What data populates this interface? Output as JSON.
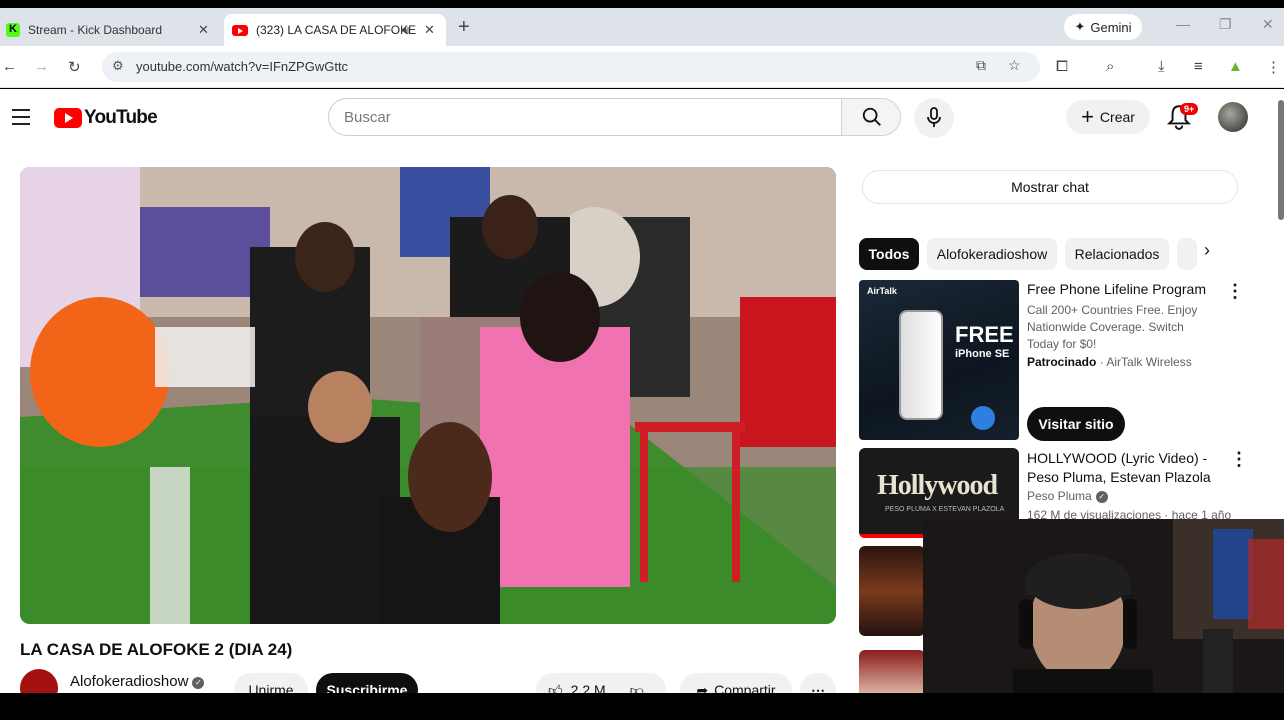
{
  "browser": {
    "tabs": [
      {
        "title": "Stream - Kick Dashboard",
        "active": false
      },
      {
        "title": "(323) LA CASA DE ALOFOKE",
        "active": true
      }
    ],
    "url": "youtube.com/watch?v=IFnZPGwGttc",
    "gemini_label": "Gemini"
  },
  "youtube": {
    "logo_text": "YouTube",
    "search_placeholder": "Buscar",
    "create_label": "Crear",
    "notification_badge": "9+"
  },
  "video": {
    "title": "LA CASA DE ALOFOKE 2 (DIA 24)",
    "channel": "Alofokeradioshow",
    "join_label": "Unirme",
    "subscribe_label": "Suscribirme",
    "likes": "2,2 M",
    "share_label": "Compartir"
  },
  "sidebar": {
    "show_chat": "Mostrar chat",
    "chips": [
      "Todos",
      "Alofokeradioshow",
      "Relacionados"
    ],
    "ad": {
      "title": "Free Phone Lifeline Program",
      "description": "Call 200+ Countries Free. Enjoy Nationwide Coverage. Switch Today for $0!",
      "sponsored": "Patrocinado",
      "advertiser": "AirTalk Wireless",
      "cta": "Visitar sitio",
      "thumb_brand": "AirTalk",
      "thumb_headline": "FREE",
      "thumb_sub": "iPhone SE"
    },
    "recommendations": [
      {
        "title": "HOLLYWOOD (Lyric Video) - Peso Pluma, Estevan Plazola",
        "channel": "Peso Pluma",
        "meta": "162 M de visualizaciones · hace 1 año",
        "thumb_text": "Hollywood",
        "thumb_sub": "PESO PLUMA X ESTEVAN PLAZOLA"
      }
    ]
  },
  "colors": {
    "youtube_red": "#ff0000",
    "kick_green": "#53fc18",
    "chip_selected": "#0f0f0f"
  }
}
